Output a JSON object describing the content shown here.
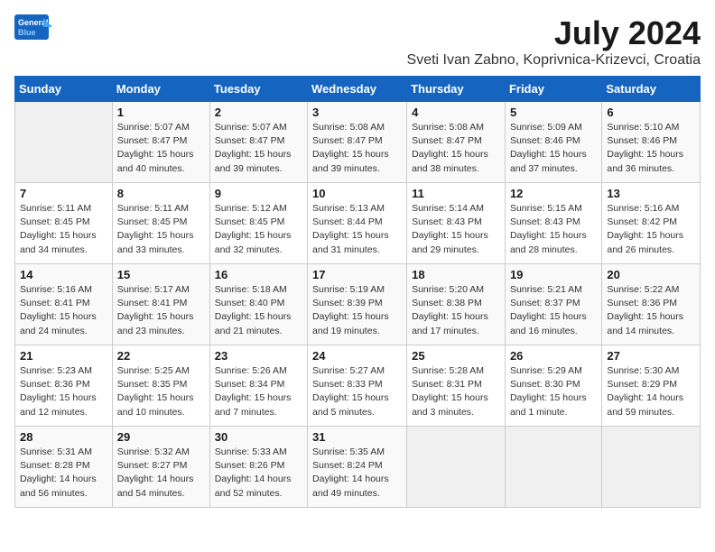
{
  "header": {
    "logo_general": "General",
    "logo_blue": "Blue",
    "month": "July 2024",
    "location": "Sveti Ivan Zabno, Koprivnica-Krizevci, Croatia"
  },
  "days_of_week": [
    "Sunday",
    "Monday",
    "Tuesday",
    "Wednesday",
    "Thursday",
    "Friday",
    "Saturday"
  ],
  "weeks": [
    [
      {
        "date": "",
        "info": ""
      },
      {
        "date": "1",
        "info": "Sunrise: 5:07 AM\nSunset: 8:47 PM\nDaylight: 15 hours\nand 40 minutes."
      },
      {
        "date": "2",
        "info": "Sunrise: 5:07 AM\nSunset: 8:47 PM\nDaylight: 15 hours\nand 39 minutes."
      },
      {
        "date": "3",
        "info": "Sunrise: 5:08 AM\nSunset: 8:47 PM\nDaylight: 15 hours\nand 39 minutes."
      },
      {
        "date": "4",
        "info": "Sunrise: 5:08 AM\nSunset: 8:47 PM\nDaylight: 15 hours\nand 38 minutes."
      },
      {
        "date": "5",
        "info": "Sunrise: 5:09 AM\nSunset: 8:46 PM\nDaylight: 15 hours\nand 37 minutes."
      },
      {
        "date": "6",
        "info": "Sunrise: 5:10 AM\nSunset: 8:46 PM\nDaylight: 15 hours\nand 36 minutes."
      }
    ],
    [
      {
        "date": "7",
        "info": "Sunrise: 5:11 AM\nSunset: 8:45 PM\nDaylight: 15 hours\nand 34 minutes."
      },
      {
        "date": "8",
        "info": "Sunrise: 5:11 AM\nSunset: 8:45 PM\nDaylight: 15 hours\nand 33 minutes."
      },
      {
        "date": "9",
        "info": "Sunrise: 5:12 AM\nSunset: 8:45 PM\nDaylight: 15 hours\nand 32 minutes."
      },
      {
        "date": "10",
        "info": "Sunrise: 5:13 AM\nSunset: 8:44 PM\nDaylight: 15 hours\nand 31 minutes."
      },
      {
        "date": "11",
        "info": "Sunrise: 5:14 AM\nSunset: 8:43 PM\nDaylight: 15 hours\nand 29 minutes."
      },
      {
        "date": "12",
        "info": "Sunrise: 5:15 AM\nSunset: 8:43 PM\nDaylight: 15 hours\nand 28 minutes."
      },
      {
        "date": "13",
        "info": "Sunrise: 5:16 AM\nSunset: 8:42 PM\nDaylight: 15 hours\nand 26 minutes."
      }
    ],
    [
      {
        "date": "14",
        "info": "Sunrise: 5:16 AM\nSunset: 8:41 PM\nDaylight: 15 hours\nand 24 minutes."
      },
      {
        "date": "15",
        "info": "Sunrise: 5:17 AM\nSunset: 8:41 PM\nDaylight: 15 hours\nand 23 minutes."
      },
      {
        "date": "16",
        "info": "Sunrise: 5:18 AM\nSunset: 8:40 PM\nDaylight: 15 hours\nand 21 minutes."
      },
      {
        "date": "17",
        "info": "Sunrise: 5:19 AM\nSunset: 8:39 PM\nDaylight: 15 hours\nand 19 minutes."
      },
      {
        "date": "18",
        "info": "Sunrise: 5:20 AM\nSunset: 8:38 PM\nDaylight: 15 hours\nand 17 minutes."
      },
      {
        "date": "19",
        "info": "Sunrise: 5:21 AM\nSunset: 8:37 PM\nDaylight: 15 hours\nand 16 minutes."
      },
      {
        "date": "20",
        "info": "Sunrise: 5:22 AM\nSunset: 8:36 PM\nDaylight: 15 hours\nand 14 minutes."
      }
    ],
    [
      {
        "date": "21",
        "info": "Sunrise: 5:23 AM\nSunset: 8:36 PM\nDaylight: 15 hours\nand 12 minutes."
      },
      {
        "date": "22",
        "info": "Sunrise: 5:25 AM\nSunset: 8:35 PM\nDaylight: 15 hours\nand 10 minutes."
      },
      {
        "date": "23",
        "info": "Sunrise: 5:26 AM\nSunset: 8:34 PM\nDaylight: 15 hours\nand 7 minutes."
      },
      {
        "date": "24",
        "info": "Sunrise: 5:27 AM\nSunset: 8:33 PM\nDaylight: 15 hours\nand 5 minutes."
      },
      {
        "date": "25",
        "info": "Sunrise: 5:28 AM\nSunset: 8:31 PM\nDaylight: 15 hours\nand 3 minutes."
      },
      {
        "date": "26",
        "info": "Sunrise: 5:29 AM\nSunset: 8:30 PM\nDaylight: 15 hours\nand 1 minute."
      },
      {
        "date": "27",
        "info": "Sunrise: 5:30 AM\nSunset: 8:29 PM\nDaylight: 14 hours\nand 59 minutes."
      }
    ],
    [
      {
        "date": "28",
        "info": "Sunrise: 5:31 AM\nSunset: 8:28 PM\nDaylight: 14 hours\nand 56 minutes."
      },
      {
        "date": "29",
        "info": "Sunrise: 5:32 AM\nSunset: 8:27 PM\nDaylight: 14 hours\nand 54 minutes."
      },
      {
        "date": "30",
        "info": "Sunrise: 5:33 AM\nSunset: 8:26 PM\nDaylight: 14 hours\nand 52 minutes."
      },
      {
        "date": "31",
        "info": "Sunrise: 5:35 AM\nSunset: 8:24 PM\nDaylight: 14 hours\nand 49 minutes."
      },
      {
        "date": "",
        "info": ""
      },
      {
        "date": "",
        "info": ""
      },
      {
        "date": "",
        "info": ""
      }
    ]
  ]
}
